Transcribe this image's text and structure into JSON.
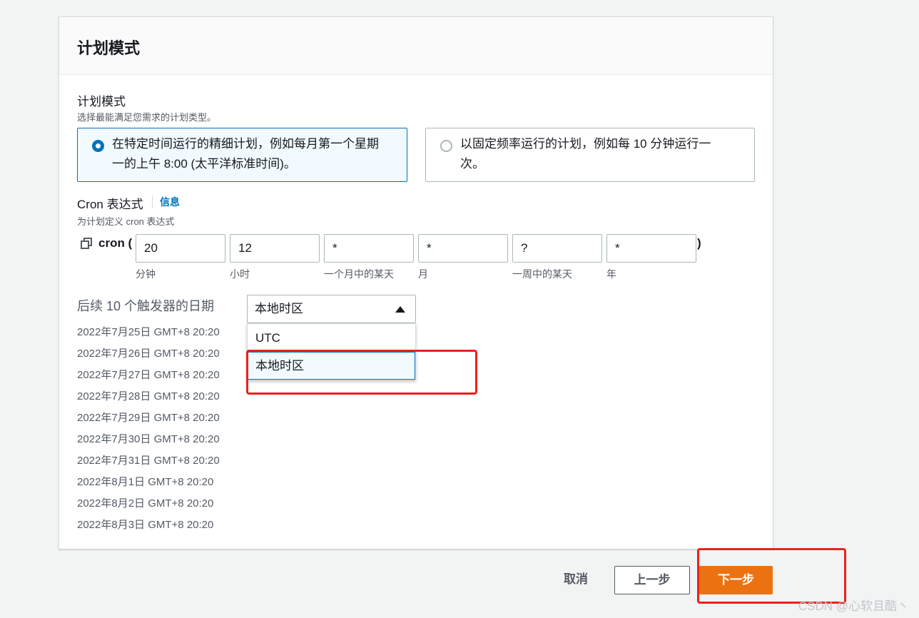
{
  "panel": {
    "title": "计划模式"
  },
  "schedule_pattern": {
    "label": "计划模式",
    "description": "选择最能满足您需求的计划类型。",
    "options": [
      {
        "line1": "在特定时间运行的精细计划，例如每月第一个星期",
        "line2": "一的上午 8:00 (太平洋标准时间)。",
        "selected": true
      },
      {
        "line1": "以固定频率运行的计划，例如每 10 分钟运行一",
        "line2": "次。",
        "selected": false
      }
    ]
  },
  "cron": {
    "label": "Cron 表达式",
    "info_link": "信息",
    "description": "为计划定义 cron 表达式",
    "prefix": "cron (",
    "suffix": ")",
    "fields": [
      {
        "value": "20",
        "caption": "分钟"
      },
      {
        "value": "12",
        "caption": "小时"
      },
      {
        "value": "*",
        "caption": "一个月中的某天"
      },
      {
        "value": "*",
        "caption": "月"
      },
      {
        "value": "?",
        "caption": "一周中的某天"
      },
      {
        "value": "*",
        "caption": "年"
      }
    ]
  },
  "next_triggers": {
    "label": "后续 10 个触发器的日期",
    "dates": [
      "2022年7月25日 GMT+8 20:20",
      "2022年7月26日 GMT+8 20:20",
      "2022年7月27日 GMT+8 20:20",
      "2022年7月28日 GMT+8 20:20",
      "2022年7月29日 GMT+8 20:20",
      "2022年7月30日 GMT+8 20:20",
      "2022年7月31日 GMT+8 20:20",
      "2022年8月1日 GMT+8 20:20",
      "2022年8月2日 GMT+8 20:20",
      "2022年8月3日 GMT+8 20:20"
    ]
  },
  "timezone_select": {
    "selected": "本地时区",
    "options": [
      "UTC",
      "本地时区"
    ],
    "highlighted": "本地时区"
  },
  "footer": {
    "cancel": "取消",
    "previous": "上一步",
    "next": "下一步"
  },
  "watermark": "CSDN @心软且酷丶",
  "colors": {
    "accent": "#0073bb",
    "primary_button": "#ec7211",
    "annotation_red": "#e8231f"
  }
}
